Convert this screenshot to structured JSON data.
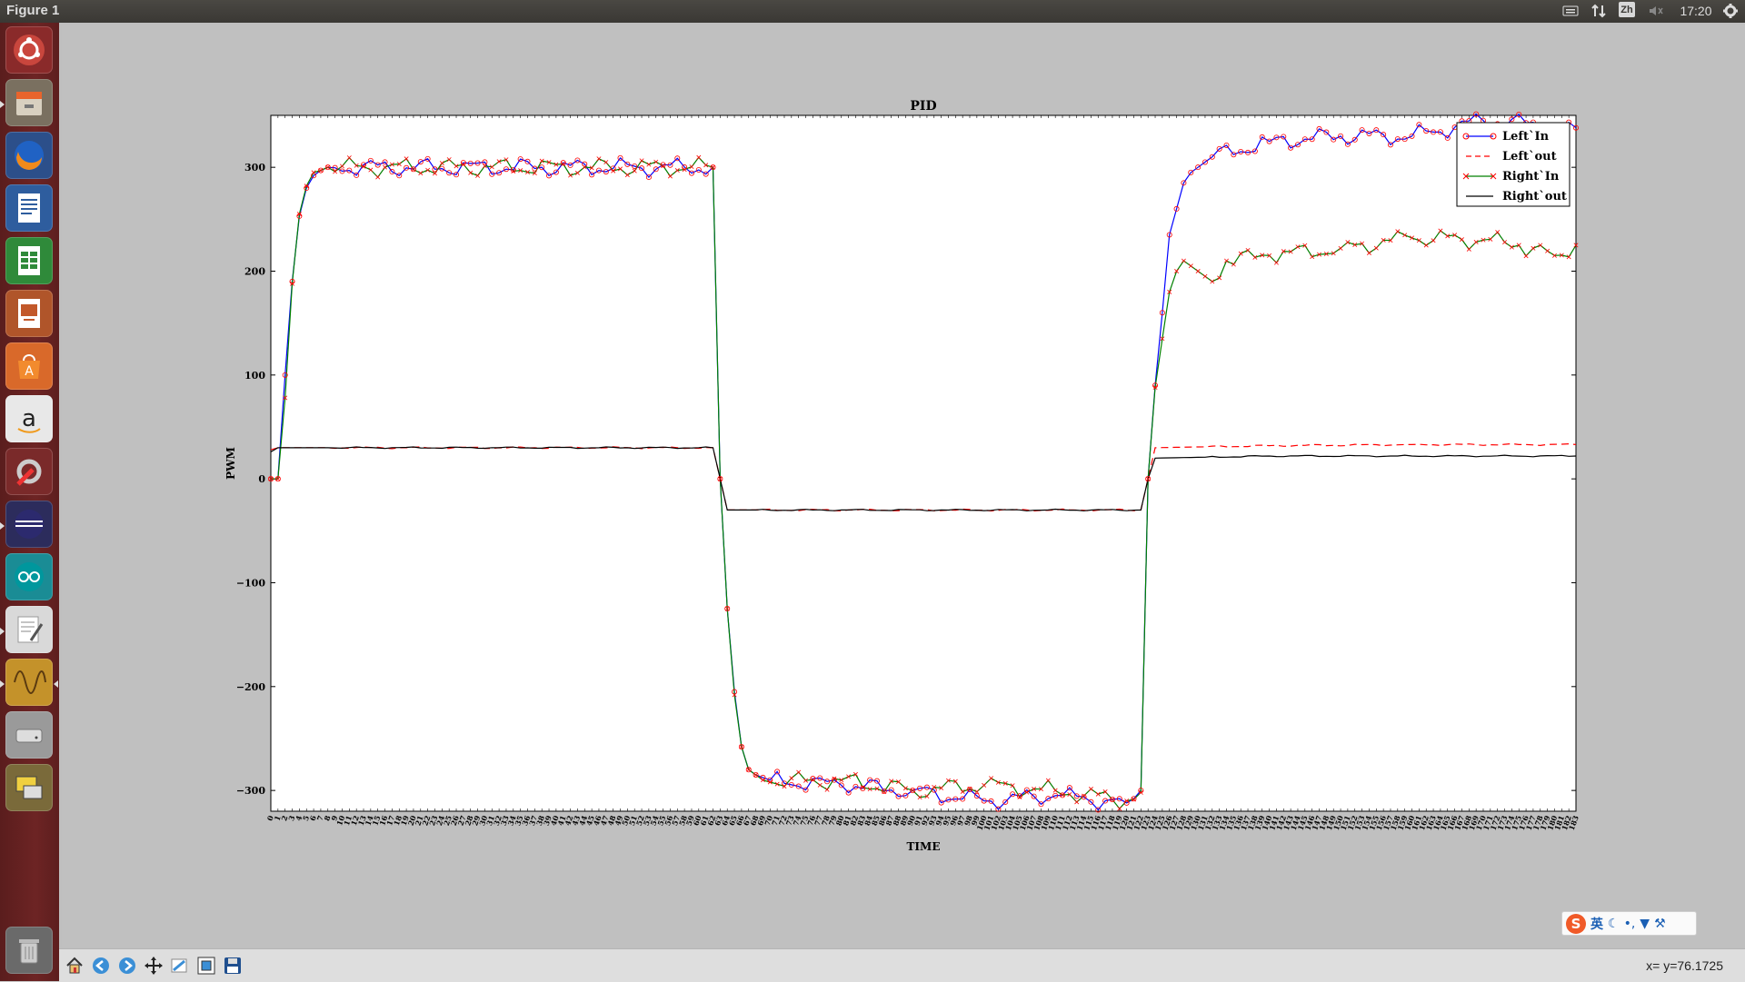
{
  "window": {
    "title": "Figure 1"
  },
  "tray": {
    "ime_label": "Zh",
    "clock": "17:20"
  },
  "colors": {
    "left_in": "#0000ff",
    "left_out": "#ff0000",
    "right_in": "#008000",
    "right_out": "#000000",
    "marker_edge_left": "#ff0000",
    "marker_edge_right": "#ff0000"
  },
  "launcher": {
    "icons": [
      "ubuntu-dash-icon",
      "files-icon",
      "firefox-icon",
      "writer-icon",
      "calc-icon",
      "impress-icon",
      "software-center-icon",
      "amazon-icon",
      "system-settings-icon",
      "eclipse-icon",
      "arduino-icon",
      "text-editor-icon",
      "oscilloscope-icon",
      "disk-icon",
      "remote-desktop-icon",
      "trash-icon"
    ]
  },
  "toolbar": {
    "buttons": [
      "home-icon",
      "back-icon",
      "forward-icon",
      "pan-icon",
      "zoom-icon",
      "subplots-icon",
      "save-icon"
    ],
    "coord": "x= y=76.1725"
  },
  "ime": {
    "lang": "英",
    "logo": "S"
  },
  "chart_data": {
    "type": "line",
    "title": "PID",
    "xlabel": "TIME",
    "ylabel": "PWM",
    "xlim": [
      0,
      183
    ],
    "ylim": [
      -320,
      350
    ],
    "yticks": [
      300,
      200,
      100,
      0,
      -100,
      -200,
      -300
    ],
    "ytick_labels": [
      "300",
      "200",
      "100",
      "0",
      "−100",
      "−200",
      "−300"
    ],
    "xticks_step": 1,
    "legend_position": "top-right",
    "segments": [
      {
        "name": "rise1",
        "x": [
          0,
          1,
          2,
          3,
          4,
          5,
          6,
          7,
          8
        ]
      },
      {
        "name": "high1",
        "x": [
          9,
          62
        ]
      },
      {
        "name": "fall",
        "x": [
          63,
          64,
          65,
          66,
          67,
          68
        ]
      },
      {
        "name": "low",
        "x": [
          69,
          122
        ]
      },
      {
        "name": "rise2",
        "x": [
          123,
          124,
          125,
          126,
          127,
          128,
          129,
          130,
          131
        ]
      },
      {
        "name": "high2",
        "x": [
          132,
          183
        ]
      }
    ],
    "series": [
      {
        "name": "Left`In",
        "style": "line-circle",
        "key_points": [
          [
            0,
            0
          ],
          [
            1,
            0
          ],
          [
            2,
            100
          ],
          [
            3,
            190
          ],
          [
            4,
            253
          ],
          [
            5,
            280
          ],
          [
            6,
            292
          ],
          [
            7,
            297
          ],
          [
            8,
            300
          ],
          [
            62,
            300
          ],
          [
            63,
            0
          ],
          [
            64,
            -125
          ],
          [
            65,
            -205
          ],
          [
            66,
            -258
          ],
          [
            67,
            -280
          ],
          [
            68,
            -285
          ],
          [
            70,
            -290
          ],
          [
            80,
            -295
          ],
          [
            90,
            -300
          ],
          [
            100,
            -310
          ],
          [
            110,
            -305
          ],
          [
            120,
            -312
          ],
          [
            122,
            -300
          ],
          [
            123,
            0
          ],
          [
            124,
            90
          ],
          [
            125,
            160
          ],
          [
            126,
            235
          ],
          [
            127,
            260
          ],
          [
            128,
            285
          ],
          [
            129,
            295
          ],
          [
            130,
            300
          ],
          [
            132,
            310
          ],
          [
            140,
            325
          ],
          [
            150,
            330
          ],
          [
            160,
            330
          ],
          [
            170,
            345
          ],
          [
            180,
            340
          ],
          [
            183,
            338
          ]
        ]
      },
      {
        "name": "Left`out",
        "style": "dashed",
        "key_points": [
          [
            0,
            28
          ],
          [
            1,
            30
          ],
          [
            62,
            30
          ],
          [
            63,
            0
          ],
          [
            64,
            -30
          ],
          [
            122,
            -30
          ],
          [
            123,
            0
          ],
          [
            124,
            30
          ],
          [
            140,
            32
          ],
          [
            160,
            33
          ],
          [
            183,
            33
          ]
        ]
      },
      {
        "name": "Right`In",
        "style": "line-x",
        "key_points": [
          [
            0,
            0
          ],
          [
            1,
            0
          ],
          [
            2,
            78
          ],
          [
            3,
            188
          ],
          [
            4,
            255
          ],
          [
            5,
            282
          ],
          [
            6,
            295
          ],
          [
            7,
            297
          ],
          [
            8,
            300
          ],
          [
            62,
            300
          ],
          [
            63,
            0
          ],
          [
            64,
            -125
          ],
          [
            65,
            -208
          ],
          [
            66,
            -258
          ],
          [
            67,
            -280
          ],
          [
            68,
            -285
          ],
          [
            70,
            -292
          ],
          [
            80,
            -290
          ],
          [
            90,
            -300
          ],
          [
            100,
            -295
          ],
          [
            110,
            -300
          ],
          [
            120,
            -310
          ],
          [
            122,
            -302
          ],
          [
            123,
            0
          ],
          [
            124,
            88
          ],
          [
            125,
            135
          ],
          [
            126,
            180
          ],
          [
            127,
            200
          ],
          [
            128,
            210
          ],
          [
            130,
            200
          ],
          [
            132,
            190
          ],
          [
            134,
            210
          ],
          [
            140,
            215
          ],
          [
            150,
            222
          ],
          [
            160,
            232
          ],
          [
            170,
            230
          ],
          [
            175,
            225
          ],
          [
            180,
            215
          ],
          [
            183,
            225
          ]
        ]
      },
      {
        "name": "Right`out",
        "style": "solid",
        "key_points": [
          [
            0,
            26
          ],
          [
            1,
            30
          ],
          [
            62,
            30
          ],
          [
            63,
            0
          ],
          [
            64,
            -30
          ],
          [
            122,
            -30
          ],
          [
            123,
            0
          ],
          [
            124,
            20
          ],
          [
            140,
            22
          ],
          [
            160,
            22
          ],
          [
            183,
            22
          ]
        ]
      }
    ]
  }
}
